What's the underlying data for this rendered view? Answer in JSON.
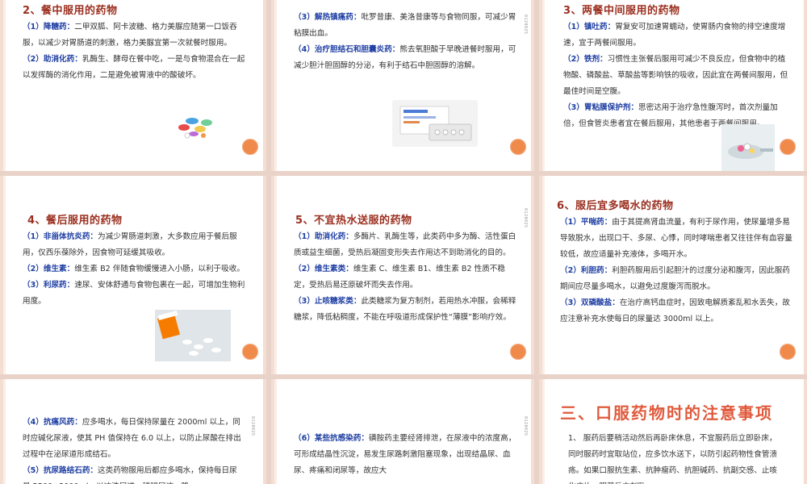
{
  "slides": [
    {
      "title": "2、餐中服用的药物",
      "paras": [
        {
          "kw": "（1）降糖药：",
          "text": "二甲双胍、阿卡波糖、格力美脲应随第一口饭吞服，以减少对胃肠道的刺激，格力美脲宜第一次就餐时服用。"
        },
        {
          "kw": "（2）助消化药：",
          "text": "乳酶生、酵母在餐中吃，一是与食物混合在一起以发挥酶的消化作用，二是避免被胃液中的酸破坏。"
        }
      ],
      "image": "capsules-pills-image"
    },
    {
      "title": "",
      "paras": [
        {
          "kw": "（3）解热镇痛药：",
          "text": "吡罗昔康、美洛昔康等与食物同服，可减少胃粘膜出血。"
        },
        {
          "kw": "（4）治疗胆结石和胆囊炎药：",
          "text": "熊去氧胆酸于早晚进餐时服用，可减少胆汁胆固醇的分泌，有利于结石中胆固醇的溶解。"
        }
      ],
      "image": "medicine-box-image",
      "side_number": "0120025"
    },
    {
      "title": "3、两餐中间服用的药物",
      "paras": [
        {
          "kw": "（1）镇吐药：",
          "text": "胃复安可加速胃蠕动，使胃肠内食物的排空速度增速，宜于两餐间服用。"
        },
        {
          "kw": "（2）铁剂：",
          "text": "习惯性主张餐后服用可减少不良反应，但食物中的植物酸、磷酸盐、草酸盐等影响铁的吸收，因此宜在两餐间服用，但最佳时间是空腹。"
        },
        {
          "kw": "（3）胃粘膜保护剂：",
          "text": "思密达用于治疗急性腹泻时，首次剂量加倍，但食管炎患者宜在餐后服用，其他患者于两餐间服用。"
        }
      ],
      "image": "pills-spoon-image"
    },
    {
      "title": "4、餐后服用的药物",
      "paras": [
        {
          "kw": "（1）非甾体抗炎药：",
          "text": "为减少胃肠道刺激，大多数应用于餐后服用，仅西乐葆除外，因食物可延缓其吸收。"
        },
        {
          "kw": "（2）维生素：",
          "text": "维生素 B2 伴随食物缓慢进入小肠，以利于吸收。"
        },
        {
          "kw": "（3）利尿药：",
          "text": "速尿、安体舒通与食物包裹在一起，可增加生物利用度。"
        }
      ],
      "image": "pill-bottle-image"
    },
    {
      "title": "5、不宜热水送服的药物",
      "paras": [
        {
          "kw": "（1）助消化药：",
          "text": "多酶片、乳酶生等，此类药中多为酶、活性蛋白质或益生细菌，受热后凝固变形失去作用达不到助消化的目的。"
        },
        {
          "kw": "（2）维生素类：",
          "text": "维生素 C、维生素 B1、维生素 B2 性质不稳定，受热后易还原破坏而失去作用。"
        },
        {
          "kw": "（3）止咳糖浆类：",
          "text": "此类糖浆为复方制剂，若用热水冲服，会稀释糖浆，降低粘稠度，不能在呼吸道形成保护性“薄膜”影响疗效。"
        }
      ],
      "side_number": "0120025"
    },
    {
      "title": "6、服后宜多喝水的药物",
      "paras": [
        {
          "kw": "（1）平喘药：",
          "text": "由于其提高肾血流量，有利于尿作用，使尿量增多易导致脱水，出现口干、多尿、心悸，同时哮喘患者又往往伴有血容量较低，故应适量补充液体，多喝开水。"
        },
        {
          "kw": "（2）利胆药：",
          "text": "利胆药服用后引起胆汁的过度分泌和腹泻，因此服药期间应尽量多喝水，以避免过度腹泻而脱水。"
        },
        {
          "kw": "（3）双磷酸盐：",
          "text": "在治疗高钙血症时，因致电解质紊乱和水丢失，故应注意补充水使每日的尿量达 3000ml 以上。"
        }
      ]
    },
    {
      "title": "",
      "paras": [
        {
          "kw": "（4）抗痛风药：",
          "text": "应多喝水，每日保持尿量在 2000ml 以上，同时应碱化尿液，使其 PH 值保持在 6.0 以上，以防止尿酸在排出过程中在泌尿道形成结石。"
        },
        {
          "kw": "（5）抗尿路结石药：",
          "text": "这类药物服用后都应多喝水，保持每日尿量 2500~3000ml，以冲洗尿道，稀释尿液，降"
        }
      ],
      "side_number": "0120025"
    },
    {
      "title": "",
      "paras": [
        {
          "kw": "（6）某些抗感染药：",
          "text": "磺胺药主要经肾排泄，在尿液中的浓度高，可形成结晶性沉淀，易发生尿路刺激阻塞现象，出现结晶尿、血尿、疼痛和闭尿等，故应大"
        }
      ],
      "side_number": "0120025"
    },
    {
      "title": "三、口服药物时的注意事项",
      "paras": [
        {
          "kw": "",
          "text": "1、 服药后要稍活动然后再卧床休息，不宜服药后立即卧床，同时服药时宜取站位，应多饮水送下，以防引起药物性食管溃疡。如果口服抗生素、抗肿瘤药、抗胆碱药、抗副交感、止咳化痰片、服药后立刻卧"
        }
      ]
    }
  ]
}
